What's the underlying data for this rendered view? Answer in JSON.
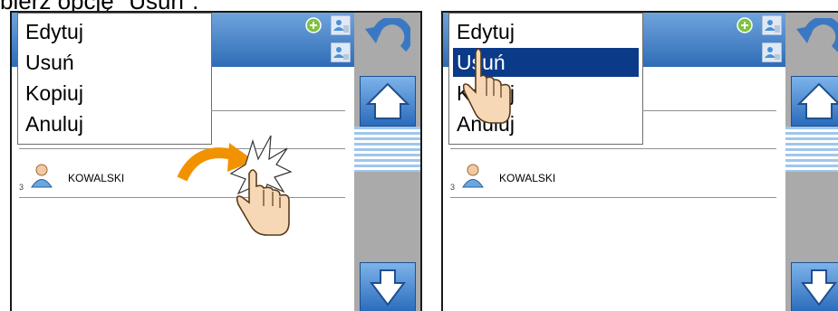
{
  "caption": "bierz opcję \"Usuń\".",
  "panels": [
    {
      "menu": {
        "items": [
          "Edytuj",
          "Usuń",
          "Kopiuj",
          "Anuluj"
        ],
        "selected_index": -1
      },
      "list": {
        "rows": [
          {
            "number": "3",
            "name": "KOWALSKI"
          }
        ]
      }
    },
    {
      "menu": {
        "items": [
          "Edytuj",
          "Usuń",
          "Kopiuj",
          "Anuluj"
        ],
        "selected_index": 1
      },
      "list": {
        "rows": [
          {
            "number": "3",
            "name": "KOWALSKI"
          }
        ]
      }
    }
  ],
  "icons": {
    "header": [
      "add-icon",
      "user-filter-icon",
      "user-settings-icon"
    ],
    "side": [
      "undo-icon",
      "home-icon",
      "scroll-icon",
      "arrow-down-icon"
    ]
  },
  "colors": {
    "header": "#2f6cb7",
    "selection": "#0b3a88",
    "sidebar": "#aaaaaa",
    "arrow": "#f39200"
  }
}
